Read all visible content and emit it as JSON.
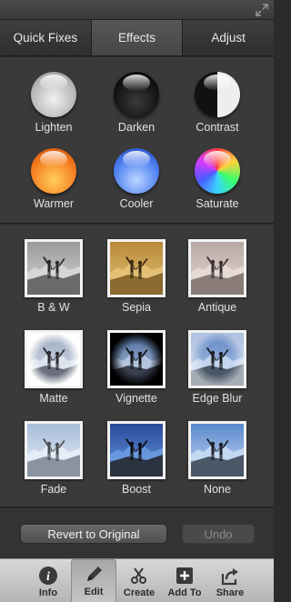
{
  "tabs": [
    {
      "label": "Quick Fixes",
      "active": false
    },
    {
      "label": "Effects",
      "active": true
    },
    {
      "label": "Adjust",
      "active": false
    }
  ],
  "adjustments": [
    {
      "label": "Lighten",
      "icon": "lighten-orb"
    },
    {
      "label": "Darken",
      "icon": "darken-orb"
    },
    {
      "label": "Contrast",
      "icon": "contrast-orb"
    },
    {
      "label": "Warmer",
      "icon": "warmer-orb"
    },
    {
      "label": "Cooler",
      "icon": "cooler-orb"
    },
    {
      "label": "Saturate",
      "icon": "saturate-orb"
    }
  ],
  "effects": [
    {
      "label": "B & W"
    },
    {
      "label": "Sepia"
    },
    {
      "label": "Antique"
    },
    {
      "label": "Matte"
    },
    {
      "label": "Vignette"
    },
    {
      "label": "Edge Blur"
    },
    {
      "label": "Fade"
    },
    {
      "label": "Boost"
    },
    {
      "label": "None"
    }
  ],
  "actions": {
    "revert": "Revert to Original",
    "undo": "Undo"
  },
  "toolbar": [
    {
      "label": "Info",
      "icon": "info-icon"
    },
    {
      "label": "Edit",
      "icon": "pencil-icon",
      "active": true
    },
    {
      "label": "Create",
      "icon": "create-icon"
    },
    {
      "label": "Add To",
      "icon": "add-icon"
    },
    {
      "label": "Share",
      "icon": "share-icon"
    }
  ]
}
